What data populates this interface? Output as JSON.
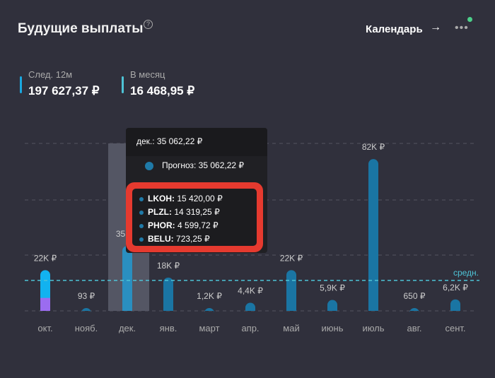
{
  "header": {
    "title": "Будущие выплаты",
    "help_icon": "?",
    "calendar_label": "Календарь",
    "arrow": "→",
    "more": "•••"
  },
  "stats": [
    {
      "label": "След. 12м",
      "value": "197 627,37 ₽",
      "color": "#1aa8e0"
    },
    {
      "label": "В месяц",
      "value": "16 468,95 ₽",
      "color": "#4ec3d6"
    }
  ],
  "chart_data": {
    "type": "bar",
    "categories": [
      "окт.",
      "нояб.",
      "дек.",
      "янв.",
      "март",
      "апр.",
      "май",
      "июнь",
      "июль",
      "авг.",
      "сент."
    ],
    "values": [
      22000,
      93,
      35062.22,
      18000,
      1200,
      4400,
      22000,
      5900,
      82000,
      650,
      6200
    ],
    "data_labels": [
      "22K ₽",
      "93 ₽",
      "35K ₽",
      "18K ₽",
      "1,2K ₽",
      "4,4K ₽",
      "22K ₽",
      "5,9K ₽",
      "82K ₽",
      "650 ₽",
      "6,2K ₽"
    ],
    "oct_split": {
      "received": 7000,
      "received_color": "#9b6cf0",
      "forecast_color": "#12b2f0"
    },
    "bar_color": "#1a75a3",
    "average": {
      "label": "средн.",
      "value": 16468.95,
      "color": "#4ec3d6"
    },
    "ylim": [
      0,
      90000
    ],
    "highlighted": "дек."
  },
  "tooltip": {
    "title": "дек.: 35 062,22 ₽",
    "forecast": "Прогноз: 35 062,22 ₽",
    "items": [
      {
        "ticker": "LKOH:",
        "value": "15 420,00 ₽"
      },
      {
        "ticker": "PLZL:",
        "value": "14 319,25 ₽"
      },
      {
        "ticker": "PHOR:",
        "value": "4 599,72 ₽"
      },
      {
        "ticker": "BELU:",
        "value": "723,25 ₽"
      }
    ]
  }
}
